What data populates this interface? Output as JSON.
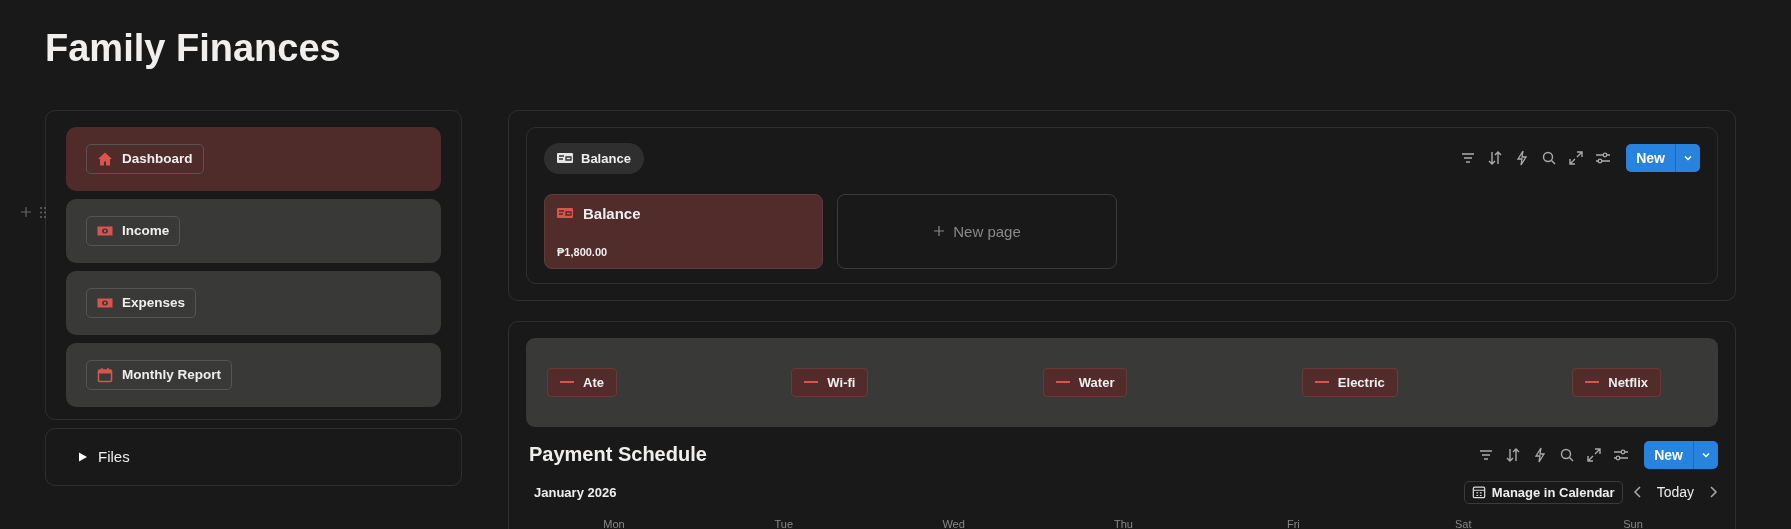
{
  "page": {
    "title": "Family Finances"
  },
  "nav": {
    "items": [
      {
        "label": "Dashboard",
        "kind": "house",
        "selected": true
      },
      {
        "label": "Income",
        "kind": "money",
        "selected": false
      },
      {
        "label": "Expenses",
        "kind": "money",
        "selected": false
      },
      {
        "label": "Monthly Report",
        "kind": "calendar",
        "selected": false
      }
    ]
  },
  "files": {
    "label": "Files",
    "expanded": false
  },
  "balance": {
    "view_tab": "Balance",
    "new_label": "New",
    "cards": [
      {
        "title": "Balance",
        "amount": "₱1,800.00"
      }
    ],
    "new_page_label": "New page"
  },
  "bills": {
    "tags": [
      "Ate",
      "Wi-fi",
      "Water",
      "Electric",
      "Netflix"
    ]
  },
  "schedule": {
    "title": "Payment Schedule",
    "new_label": "New",
    "month": "January 2026",
    "manage_label": "Manage in Calendar",
    "today_label": "Today",
    "weekdays": [
      "Mon",
      "Tue",
      "Wed",
      "Thu",
      "Fri",
      "Sat",
      "Sun"
    ]
  }
}
